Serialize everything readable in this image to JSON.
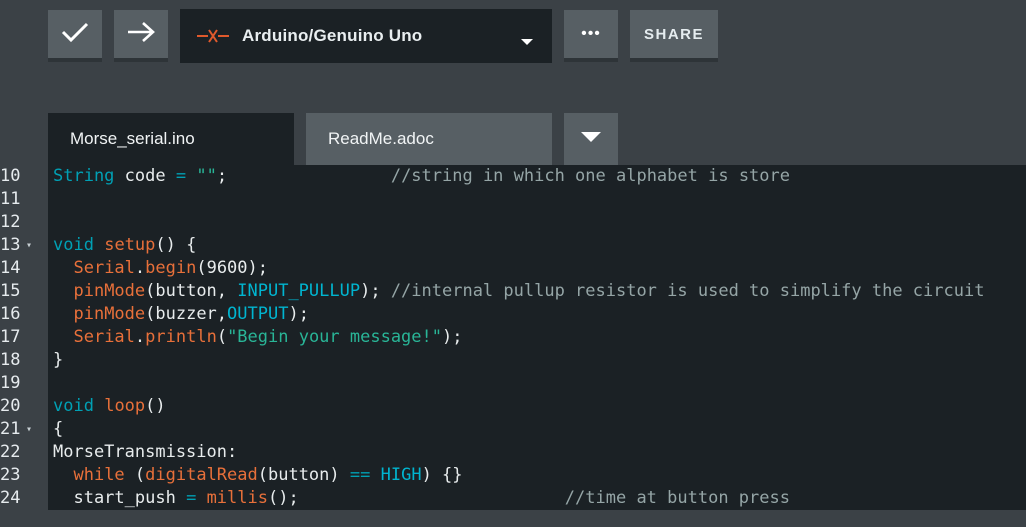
{
  "toolbar": {
    "verify_icon": "checkmark-icon",
    "upload_icon": "arrow-right-icon",
    "board": {
      "name": "Arduino/Genuino Uno",
      "icon": "disconnected-plug-icon",
      "accent": "#e0592c"
    },
    "more_label": "•••",
    "share_label": "SHARE"
  },
  "tabs": [
    {
      "label": "Morse_serial.ino",
      "active": true
    },
    {
      "label": "ReadMe.adoc",
      "active": false
    }
  ],
  "editor": {
    "lines": [
      {
        "n": "10",
        "fold": "",
        "tokens": [
          [
            "key",
            "String"
          ],
          [
            "txt",
            " code "
          ],
          [
            "key",
            "="
          ],
          [
            "txt",
            " "
          ],
          [
            "str",
            "\"\""
          ],
          [
            "txt",
            ";                "
          ],
          [
            "com",
            "//string in which one alphabet is store"
          ]
        ]
      },
      {
        "n": "11",
        "fold": "",
        "tokens": []
      },
      {
        "n": "12",
        "fold": "",
        "tokens": []
      },
      {
        "n": "13",
        "fold": "▾",
        "tokens": [
          [
            "key",
            "void"
          ],
          [
            "txt",
            " "
          ],
          [
            "fn",
            "setup"
          ],
          [
            "txt",
            "() {"
          ]
        ]
      },
      {
        "n": "14",
        "fold": "",
        "tokens": [
          [
            "txt",
            "  "
          ],
          [
            "fn",
            "Serial"
          ],
          [
            "txt",
            "."
          ],
          [
            "fn",
            "begin"
          ],
          [
            "txt",
            "(9600);"
          ]
        ]
      },
      {
        "n": "15",
        "fold": "",
        "tokens": [
          [
            "txt",
            "  "
          ],
          [
            "fn",
            "pinMode"
          ],
          [
            "txt",
            "(button, "
          ],
          [
            "const",
            "INPUT_PULLUP"
          ],
          [
            "txt",
            "); "
          ],
          [
            "com",
            "//internal pullup resistor is used to simplify the circuit"
          ]
        ]
      },
      {
        "n": "16",
        "fold": "",
        "tokens": [
          [
            "txt",
            "  "
          ],
          [
            "fn",
            "pinMode"
          ],
          [
            "txt",
            "(buzzer,"
          ],
          [
            "const",
            "OUTPUT"
          ],
          [
            "txt",
            ");"
          ]
        ]
      },
      {
        "n": "17",
        "fold": "",
        "tokens": [
          [
            "txt",
            "  "
          ],
          [
            "fn",
            "Serial"
          ],
          [
            "txt",
            "."
          ],
          [
            "fn",
            "println"
          ],
          [
            "txt",
            "("
          ],
          [
            "str",
            "\"Begin your message!\""
          ],
          [
            "txt",
            ");"
          ]
        ]
      },
      {
        "n": "18",
        "fold": "",
        "tokens": [
          [
            "txt",
            "}"
          ]
        ]
      },
      {
        "n": "19",
        "fold": "",
        "tokens": []
      },
      {
        "n": "20",
        "fold": "",
        "tokens": [
          [
            "key",
            "void"
          ],
          [
            "txt",
            " "
          ],
          [
            "fn",
            "loop"
          ],
          [
            "txt",
            "()"
          ]
        ]
      },
      {
        "n": "21",
        "fold": "▾",
        "tokens": [
          [
            "txt",
            "{"
          ]
        ]
      },
      {
        "n": "22",
        "fold": "",
        "tokens": [
          [
            "txt",
            "MorseTransmission:"
          ]
        ]
      },
      {
        "n": "23",
        "fold": "",
        "tokens": [
          [
            "txt",
            "  "
          ],
          [
            "fn",
            "while"
          ],
          [
            "txt",
            " ("
          ],
          [
            "fn",
            "digitalRead"
          ],
          [
            "txt",
            "(button) "
          ],
          [
            "key",
            "=="
          ],
          [
            "txt",
            " "
          ],
          [
            "const",
            "HIGH"
          ],
          [
            "txt",
            ") {}"
          ]
        ]
      },
      {
        "n": "24",
        "fold": "",
        "tokens": [
          [
            "txt",
            "  start_push "
          ],
          [
            "key",
            "="
          ],
          [
            "txt",
            " "
          ],
          [
            "fn",
            "millis"
          ],
          [
            "txt",
            "();                          "
          ],
          [
            "com",
            "//time at button press"
          ]
        ]
      }
    ]
  }
}
